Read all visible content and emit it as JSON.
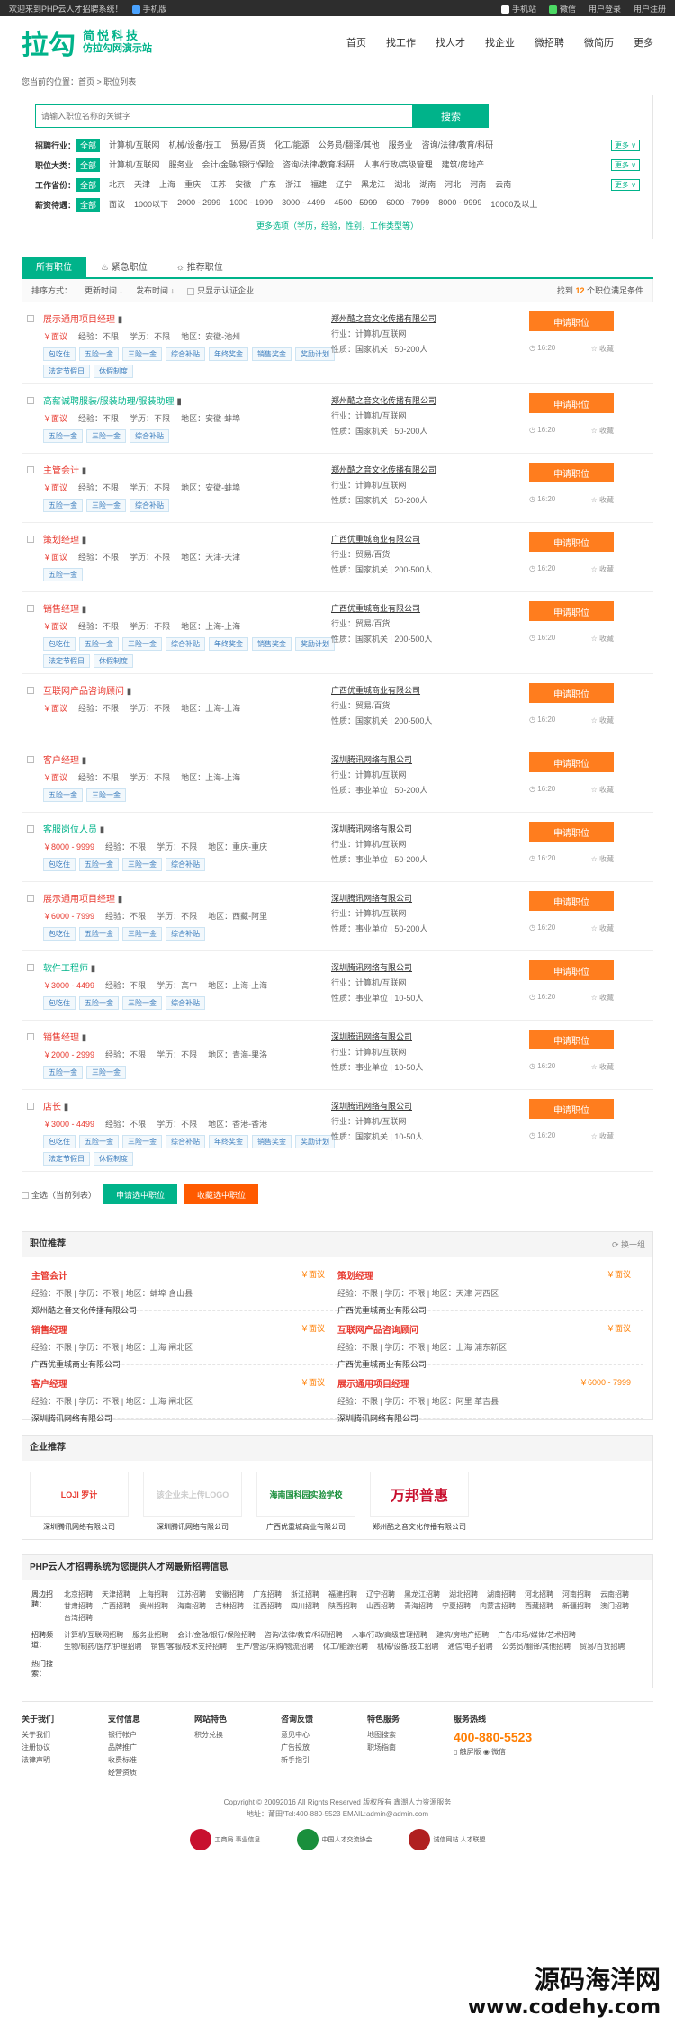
{
  "topbar": {
    "welcome": "欢迎来到PHP云人才招聘系统！",
    "mobile_edition": "手机版",
    "mobile_site": "手机站",
    "wechat": "微信",
    "user_login": "用户登录",
    "user_register": "用户注册"
  },
  "logo": {
    "mark": "拉勾",
    "line1": "简悦科技",
    "line2": "仿拉勾网演示站"
  },
  "nav": [
    "首页",
    "找工作",
    "找人才",
    "找企业",
    "微招聘",
    "微简历",
    "更多"
  ],
  "breadcrumb": "您当前的位置：首页 > 职位列表",
  "search": {
    "placeholder": "请输入职位名称的关键字",
    "button": "搜索"
  },
  "filters": [
    {
      "label": "招聘行业：",
      "options": [
        "全部",
        "计算机/互联网",
        "机械/设备/技工",
        "贸易/百货",
        "化工/能源",
        "公务员/翻译/其他",
        "服务业",
        "咨询/法律/教育/科研"
      ]
    },
    {
      "label": "职位大类：",
      "options": [
        "全部",
        "计算机/互联网",
        "服务业",
        "会计/金融/银行/保险",
        "咨询/法律/教育/科研",
        "人事/行政/高级管理",
        "建筑/房地产"
      ]
    },
    {
      "label": "工作省份：",
      "options": [
        "全部",
        "北京",
        "天津",
        "上海",
        "重庆",
        "江苏",
        "安徽",
        "广东",
        "浙江",
        "福建",
        "辽宁",
        "黑龙江",
        "湖北",
        "湖南",
        "河北",
        "河南",
        "云南"
      ]
    },
    {
      "label": "薪资待遇：",
      "options": [
        "全部",
        "面议",
        "1000以下",
        "2000 - 2999",
        "1000 - 1999",
        "3000 - 4499",
        "4500 - 5999",
        "6000 - 7999",
        "8000 - 9999",
        "10000及以上"
      ]
    }
  ],
  "more_label": "更多",
  "more_conditions": "更多选项（学历，经验，性别，工作类型等）",
  "tabs": [
    "所有职位",
    "紧急职位",
    "推荐职位"
  ],
  "sortbar": {
    "label": "排序方式：",
    "by_update": "更新时间",
    "by_publish": "发布时间",
    "verified": "只显示认证企业",
    "count_pre": "找到",
    "count": "12",
    "count_post": "个职位满足条件"
  },
  "job_labels": {
    "exp": "经验：",
    "edu": "学历：",
    "area": "地区：",
    "industry": "行业：",
    "nature": "性质：",
    "apply": "申请职位",
    "fav": "收藏"
  },
  "jobs": [
    {
      "title": "展示通用项目经理",
      "salary": "￥面议",
      "exp": "不限",
      "edu": "不限",
      "area": "安徽-池州",
      "tags": [
        "包吃住",
        "五险一金",
        "三险一金",
        "综合补贴",
        "年终奖金",
        "销售奖金",
        "奖励计划",
        "法定节假日",
        "休假制度"
      ],
      "company": "郑州酷之音文化传播有限公司",
      "industry": "计算机/互联网",
      "nature": "国家机关 | 50-200人",
      "time": "16:20"
    },
    {
      "title": "高薪诚聘服装/服装助理/服装助理",
      "salary": "￥面议",
      "exp": "不限",
      "edu": "不限",
      "area": "安徽-蚌埠",
      "tags": [
        "五险一金",
        "三险一金",
        "综合补贴"
      ],
      "company": "郑州酷之音文化传播有限公司",
      "industry": "计算机/互联网",
      "nature": "国家机关 | 50-200人",
      "time": "16:20",
      "green": true
    },
    {
      "title": "主管会计",
      "salary": "￥面议",
      "exp": "不限",
      "edu": "不限",
      "area": "安徽-蚌埠",
      "tags": [
        "五险一金",
        "三险一金",
        "综合补贴"
      ],
      "company": "郑州酷之音文化传播有限公司",
      "industry": "计算机/互联网",
      "nature": "国家机关 | 50-200人",
      "time": "16:20"
    },
    {
      "title": "策划经理",
      "salary": "￥面议",
      "exp": "不限",
      "edu": "不限",
      "area": "天津-天津",
      "tags": [
        "五险一金"
      ],
      "company": "广西优重城商业有限公司",
      "industry": "贸易/百货",
      "nature": "国家机关 | 200-500人",
      "time": "16:20"
    },
    {
      "title": "销售经理",
      "salary": "￥面议",
      "exp": "不限",
      "edu": "不限",
      "area": "上海-上海",
      "tags": [
        "包吃住",
        "五险一金",
        "三险一金",
        "综合补贴",
        "年终奖金",
        "销售奖金",
        "奖励计划",
        "法定节假日",
        "休假制度"
      ],
      "company": "广西优重城商业有限公司",
      "industry": "贸易/百货",
      "nature": "国家机关 | 200-500人",
      "time": "16:20"
    },
    {
      "title": "互联网产品咨询顾问",
      "salary": "￥面议",
      "exp": "不限",
      "edu": "不限",
      "area": "上海-上海",
      "tags": [],
      "company": "广西优重城商业有限公司",
      "industry": "贸易/百货",
      "nature": "国家机关 | 200-500人",
      "time": "16:20"
    },
    {
      "title": "客户经理",
      "salary": "￥面议",
      "exp": "不限",
      "edu": "不限",
      "area": "上海-上海",
      "tags": [
        "五险一金",
        "三险一金"
      ],
      "company": "深圳腾讯网络有限公司",
      "industry": "计算机/互联网",
      "nature": "事业单位 | 50-200人",
      "time": "16:20"
    },
    {
      "title": "客服岗位人员",
      "salary": "￥8000 - 9999",
      "exp": "不限",
      "edu": "不限",
      "area": "重庆-重庆",
      "tags": [
        "包吃住",
        "五险一金",
        "三险一金",
        "综合补贴"
      ],
      "company": "深圳腾讯网络有限公司",
      "industry": "计算机/互联网",
      "nature": "事业单位 | 50-200人",
      "time": "16:20",
      "green": true
    },
    {
      "title": "展示通用项目经理",
      "salary": "￥6000 - 7999",
      "exp": "不限",
      "edu": "不限",
      "area": "西藏-阿里",
      "tags": [
        "包吃住",
        "五险一金",
        "三险一金",
        "综合补贴"
      ],
      "company": "深圳腾讯网络有限公司",
      "industry": "计算机/互联网",
      "nature": "事业单位 | 50-200人",
      "time": "16:20"
    },
    {
      "title": "软件工程师",
      "salary": "￥3000 - 4499",
      "exp": "不限",
      "edu": "高中",
      "area": "上海-上海",
      "tags": [
        "包吃住",
        "五险一金",
        "三险一金",
        "综合补贴"
      ],
      "company": "深圳腾讯网络有限公司",
      "industry": "计算机/互联网",
      "nature": "事业单位 | 10-50人",
      "time": "16:20",
      "green": true
    },
    {
      "title": "销售经理",
      "salary": "￥2000 - 2999",
      "exp": "不限",
      "edu": "不限",
      "area": "青海-果洛",
      "tags": [
        "五险一金",
        "三险一金"
      ],
      "company": "深圳腾讯网络有限公司",
      "industry": "计算机/互联网",
      "nature": "事业单位 | 10-50人",
      "time": "16:20"
    },
    {
      "title": "店长",
      "salary": "￥3000 - 4499",
      "exp": "不限",
      "edu": "不限",
      "area": "香港-香港",
      "tags": [
        "包吃住",
        "五险一金",
        "三险一金",
        "综合补贴",
        "年终奖金",
        "销售奖金",
        "奖励计划",
        "法定节假日",
        "休假制度"
      ],
      "company": "深圳腾讯网络有限公司",
      "industry": "计算机/互联网",
      "nature": "国家机关 | 10-50人",
      "time": "16:20"
    }
  ],
  "bulk": {
    "select_all": "全选（当前列表）",
    "apply": "申请选中职位",
    "fav": "收藏选中职位"
  },
  "recommend": {
    "title": "职位推荐",
    "switch": "换一组",
    "items": [
      {
        "title": "主管会计",
        "salary": "￥面议",
        "meta": "经验：不限 | 学历：不限 | 地区：蚌埠 含山县",
        "company": "郑州酷之音文化传播有限公司"
      },
      {
        "title": "策划经理",
        "salary": "￥面议",
        "meta": "经验：不限 | 学历：不限 | 地区：天津 河西区",
        "company": "广西优重城商业有限公司"
      },
      {
        "title": "销售经理",
        "salary": "￥面议",
        "meta": "经验：不限 | 学历：不限 | 地区：上海 闸北区",
        "company": "广西优重城商业有限公司"
      },
      {
        "title": "互联网产品咨询顾问",
        "salary": "￥面议",
        "meta": "经验：不限 | 学历：不限 | 地区：上海 浦东新区",
        "company": "广西优重城商业有限公司"
      },
      {
        "title": "客户经理",
        "salary": "￥面议",
        "meta": "经验：不限 | 学历：不限 | 地区：上海 闸北区",
        "company": "深圳腾讯网络有限公司"
      },
      {
        "title": "展示通用项目经理",
        "salary": "￥6000 - 7999",
        "meta": "经验：不限 | 学历：不限 | 地区：阿里 革吉县",
        "company": "深圳腾讯网络有限公司"
      }
    ]
  },
  "enterprise": {
    "title": "企业推荐",
    "items": [
      {
        "logo_text": "LOJI 罗计",
        "name": "深圳腾讯网络有限公司",
        "color": "#e8392f"
      },
      {
        "logo_text": "该企业未上传LOGO",
        "name": "深圳腾讯网络有限公司",
        "color": "#cccccc"
      },
      {
        "logo_text": "海南国科园实验学校",
        "name": "广西优重城商业有限公司",
        "color": "#1a8f3c"
      },
      {
        "logo_text": "万邦普惠",
        "name": "郑州酷之音文化传播有限公司",
        "color": "#c8102e"
      }
    ]
  },
  "links": {
    "title": "PHP云人才招聘系统为您提供人才网最新招聘信息",
    "area_label": "周边招聘：",
    "areas": [
      "北京招聘",
      "天津招聘",
      "上海招聘",
      "江苏招聘",
      "安徽招聘",
      "广东招聘",
      "浙江招聘",
      "福建招聘",
      "辽宁招聘",
      "黑龙江招聘",
      "湖北招聘",
      "湖南招聘",
      "河北招聘",
      "河南招聘",
      "云南招聘",
      "甘肃招聘",
      "广西招聘",
      "贵州招聘",
      "海南招聘",
      "吉林招聘",
      "江西招聘",
      "四川招聘",
      "陕西招聘",
      "山西招聘",
      "青海招聘",
      "宁夏招聘",
      "内蒙古招聘",
      "西藏招聘",
      "新疆招聘",
      "澳门招聘",
      "台湾招聘"
    ],
    "job_label": "招聘频道：",
    "jobs": [
      "计算机/互联网招聘",
      "服务业招聘",
      "会计/金融/银行/保险招聘",
      "咨询/法律/教育/科研招聘",
      "人事/行政/高级管理招聘",
      "建筑/房地产招聘",
      "广告/市场/媒体/艺术招聘",
      "生物/制药/医疗/护理招聘",
      "销售/客服/技术支持招聘",
      "生产/营运/采购/物流招聘",
      "化工/能源招聘",
      "机械/设备/技工招聘",
      "通信/电子招聘",
      "公务员/翻译/其他招聘",
      "贸易/百货招聘"
    ],
    "hot_label": "热门搜索："
  },
  "footer": {
    "cols": [
      {
        "title": "关于我们",
        "items": [
          "关于我们",
          "注册协议",
          "法律声明"
        ]
      },
      {
        "title": "支付信息",
        "items": [
          "银行帐户",
          "品牌推广",
          "收费标准",
          "经营资质"
        ]
      },
      {
        "title": "网站特色",
        "items": [
          "积分兑换"
        ]
      },
      {
        "title": "咨询反馈",
        "items": [
          "意见中心",
          "广告投放",
          "新手指引"
        ]
      },
      {
        "title": "特色服务",
        "items": [
          "地图搜索",
          "职场指南"
        ]
      }
    ],
    "hotline_title": "服务热线",
    "hotline": "400-880-5523",
    "mobile": "触屏版",
    "wechat": "微信"
  },
  "copyright": "Copyright © 20092016 All Rights Reserved 版权所有 鑫潮人力资源服务",
  "address": "地址：莆田/Tel:400-880-5523 EMAIL:admin@admin.com",
  "badges": [
    "工商局 事业信息",
    "中国人才交流协会",
    "诚信网站 人才联盟"
  ],
  "watermark": {
    "cn": "源码海洋网",
    "url": "www.codehy.com"
  }
}
